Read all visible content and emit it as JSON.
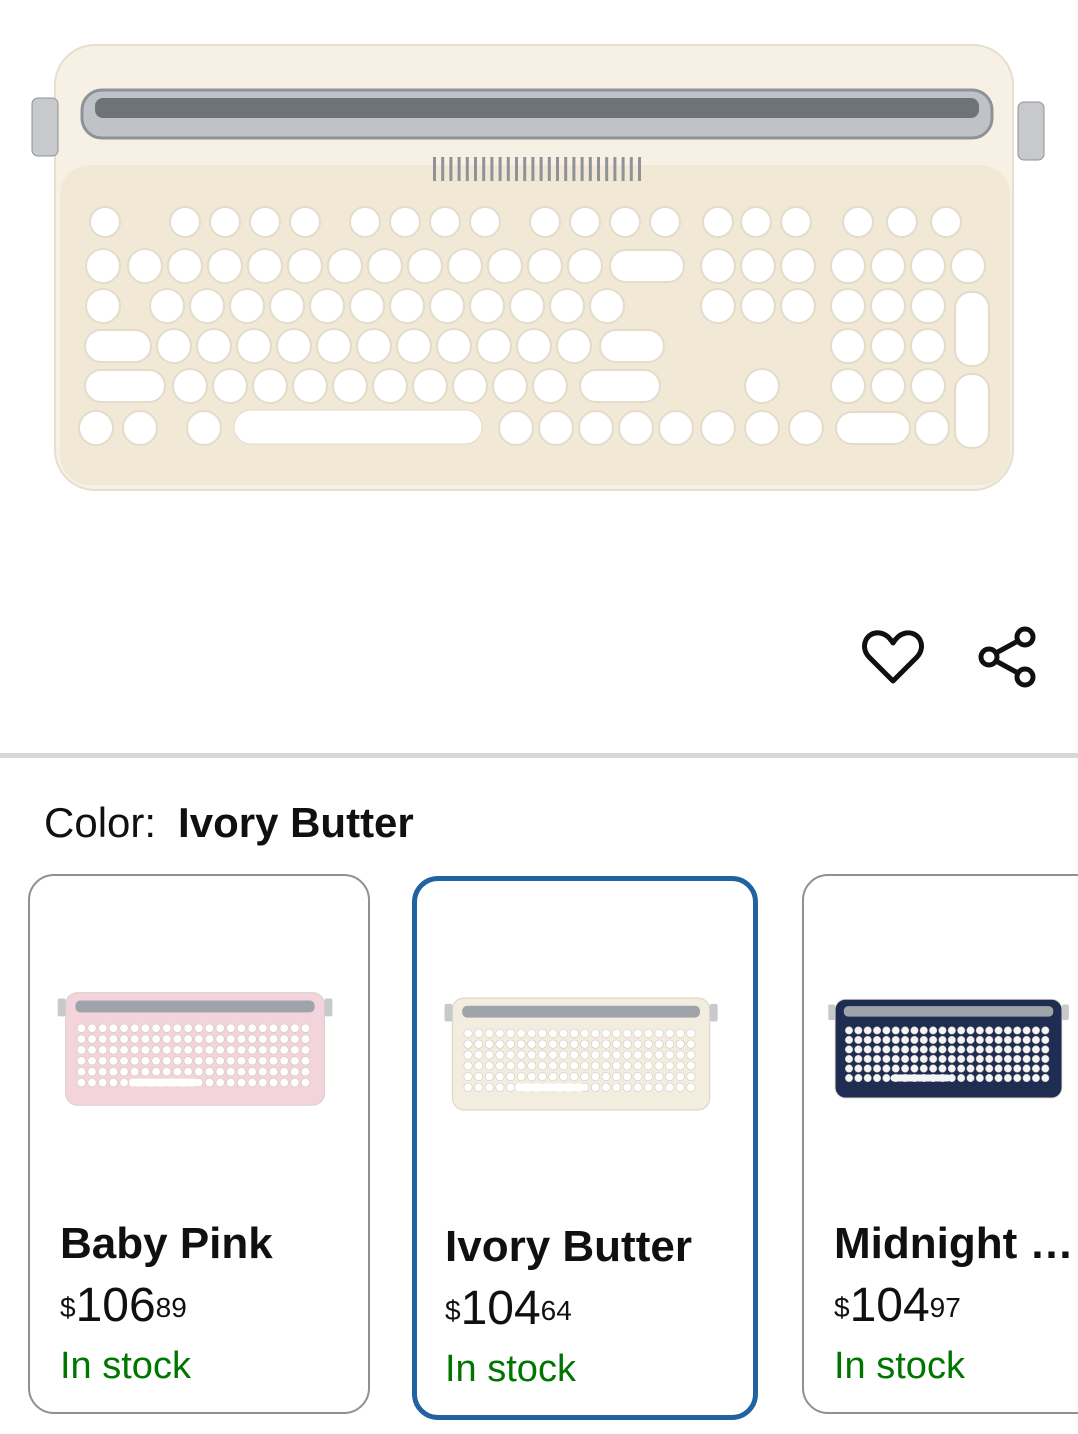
{
  "product_image": {
    "alt_icon": "keyboard-image"
  },
  "actions": {
    "wishlist_icon": "heart-icon",
    "share_icon": "share-icon"
  },
  "color": {
    "label": "Color:",
    "selected": "Ivory Butter"
  },
  "variants": [
    {
      "name": "Baby Pink",
      "currency": "$",
      "price_whole": "106",
      "price_cents": "89",
      "stock": "In stock",
      "body_color": "#f3d3dc",
      "key_color": "#ffffff",
      "selected": false
    },
    {
      "name": "Ivory Butter",
      "currency": "$",
      "price_whole": "104",
      "price_cents": "64",
      "stock": "In stock",
      "body_color": "#f3ede0",
      "key_color": "#ffffff",
      "selected": true
    },
    {
      "name": "Midnight …",
      "currency": "$",
      "price_whole": "104",
      "price_cents": "97",
      "stock": "In stock",
      "body_color": "#1f2d52",
      "key_color": "#f5f5f5",
      "selected": false
    }
  ],
  "colors": {
    "stock_green": "#007600",
    "selected_border": "#2162a1",
    "divider": "#d5d9d9"
  }
}
